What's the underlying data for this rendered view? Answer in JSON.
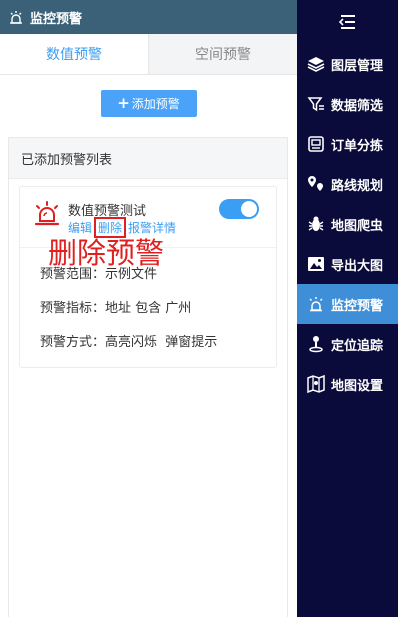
{
  "header": {
    "title": "监控预警"
  },
  "tabs": [
    {
      "label": "数值预警",
      "active": true
    },
    {
      "label": "空间预警",
      "active": false
    }
  ],
  "add_button": {
    "label": "添加预警"
  },
  "list": {
    "title": "已添加预警列表",
    "cards": [
      {
        "name": "数值预警测试",
        "actions": {
          "edit": "编辑",
          "delete": "删除",
          "details": "报警详情"
        },
        "enabled": true,
        "scope": "预警范围：示例文件",
        "indicator": "预警指标：地址 包含 广州",
        "method": "预警方式：高亮闪烁  弹窗提示"
      }
    ]
  },
  "annotation": {
    "text": "删除预警",
    "color": "#e02020"
  },
  "nav": {
    "items": [
      {
        "label": "图层管理",
        "icon": "layers-icon"
      },
      {
        "label": "数据筛选",
        "icon": "filter-icon"
      },
      {
        "label": "订单分拣",
        "icon": "sort-icon"
      },
      {
        "label": "路线规划",
        "icon": "route-icon"
      },
      {
        "label": "地图爬虫",
        "icon": "bug-icon"
      },
      {
        "label": "导出大图",
        "icon": "image-icon"
      },
      {
        "label": "监控预警",
        "icon": "monitor-icon",
        "active": true
      },
      {
        "label": "定位追踪",
        "icon": "location-icon"
      },
      {
        "label": "地图设置",
        "icon": "map-settings-icon"
      }
    ]
  },
  "colors": {
    "header_bg": "#3a6178",
    "accent": "#3b9ef5",
    "nav_bg": "#0a0b3b",
    "nav_active": "#3f8fd8",
    "alarm": "#e02020"
  }
}
